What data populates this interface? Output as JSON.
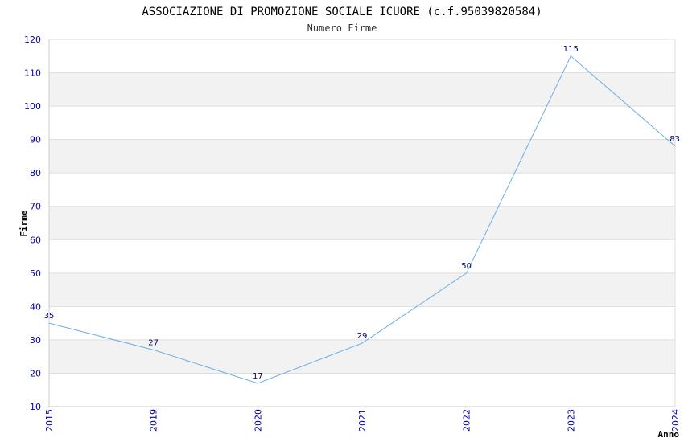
{
  "chart_data": {
    "type": "line",
    "title": "ASSOCIAZIONE DI PROMOZIONE SOCIALE ICUORE (c.f.95039820584)",
    "subtitle": "Numero Firme",
    "xlabel": "Anno",
    "ylabel": "Firme",
    "categories": [
      "2015",
      "2019",
      "2020",
      "2021",
      "2022",
      "2023",
      "2024"
    ],
    "series": [
      {
        "values": [
          35,
          27,
          17,
          29,
          50,
          115,
          88
        ]
      }
    ],
    "data_labels": [
      "35",
      "27",
      "17",
      "29",
      "50",
      "115",
      "83"
    ],
    "ylim": [
      10,
      120
    ],
    "yticks": [
      10,
      20,
      30,
      40,
      50,
      60,
      70,
      80,
      90,
      100,
      110,
      120
    ],
    "grid": "horizontal bands",
    "colors": {
      "line": "#6aaee8",
      "band": "#f2f2f2",
      "tick": "#0000aa",
      "label": "#000066"
    }
  }
}
